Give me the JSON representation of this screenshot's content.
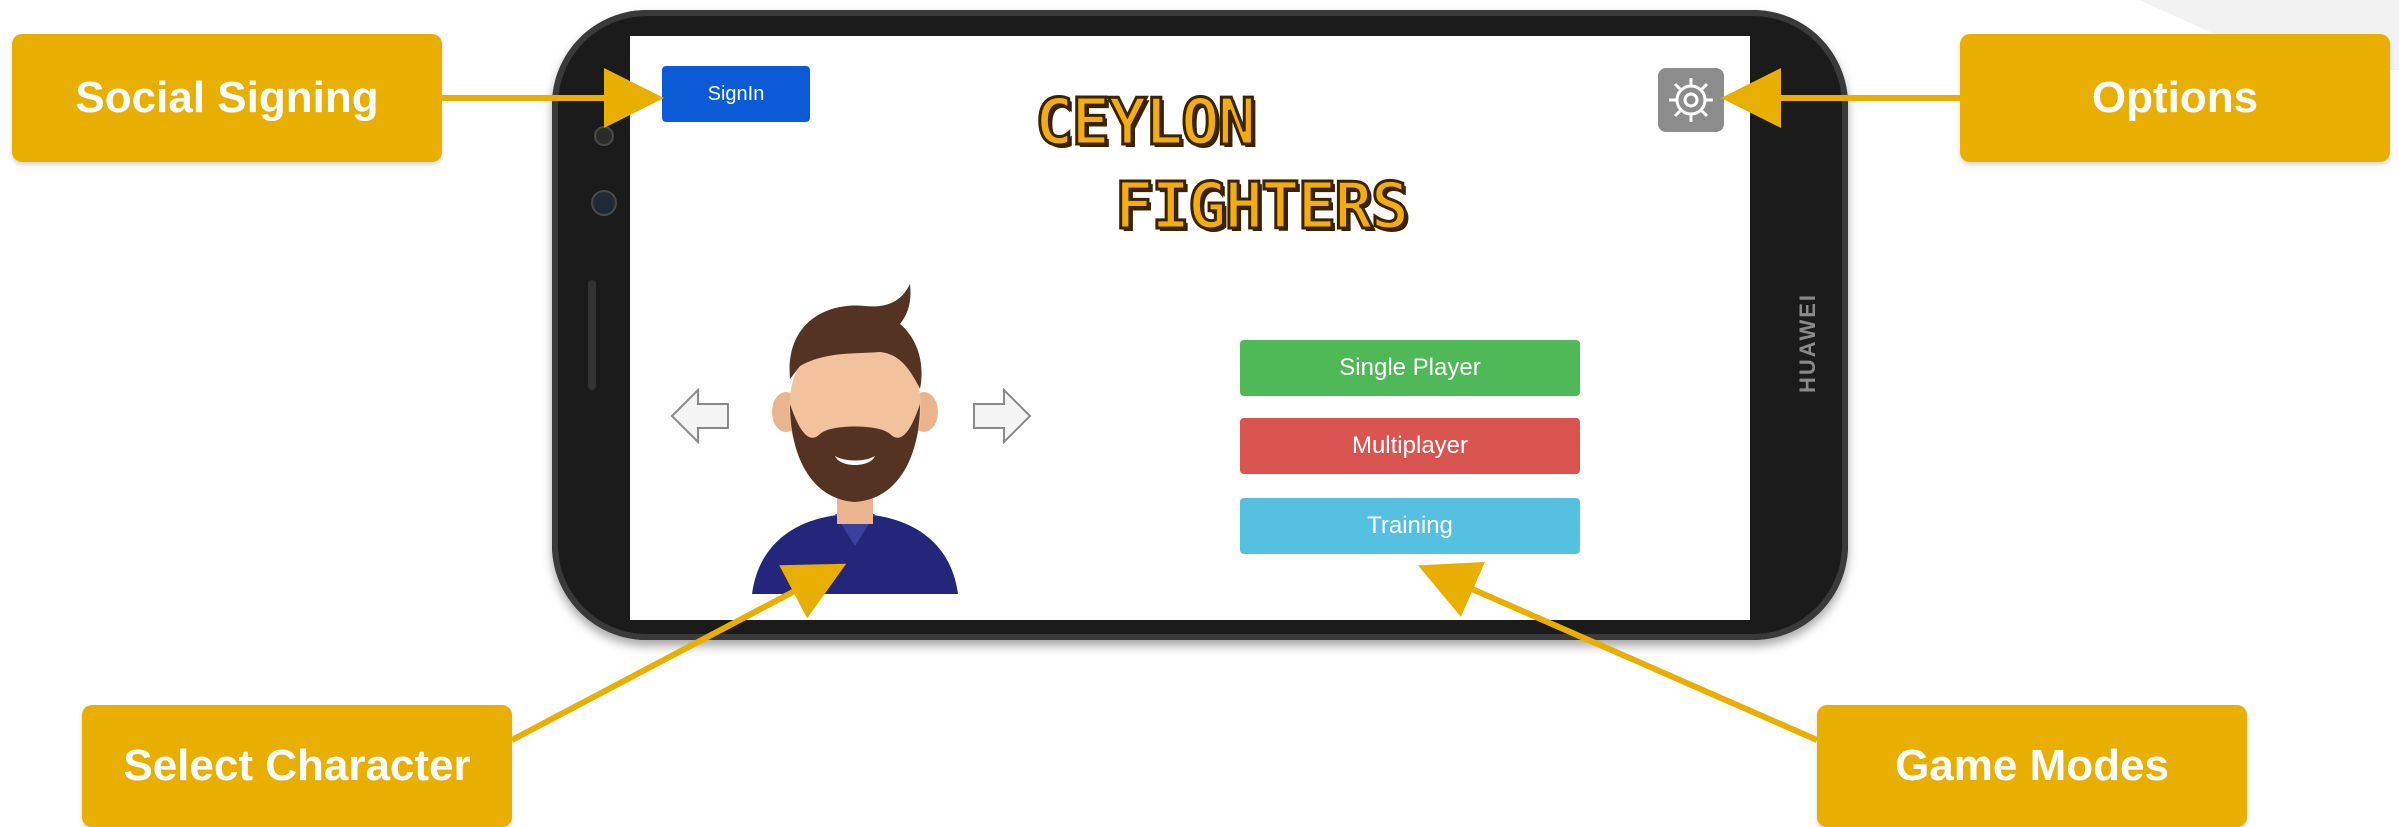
{
  "callouts": {
    "social_signing": "Social Signing",
    "options": "Options",
    "select_character": "Select Character",
    "game_modes": "Game Modes"
  },
  "phone": {
    "brand": "HUAWEI"
  },
  "app": {
    "signin_label": "SignIn",
    "logo_line1": "CEYLON",
    "logo_line2": "FIGHTERS",
    "modes": {
      "single_player": "Single Player",
      "multiplayer": "Multiplayer",
      "training": "Training"
    }
  },
  "colors": {
    "callout": "#e8ae00",
    "signin": "#0b5bd6",
    "single_player": "#4fb857",
    "multiplayer": "#d9534f",
    "training": "#55c0e0",
    "settings": "#8c8c8c"
  },
  "icons": {
    "settings": "gear-icon",
    "previous_character": "arrow-left-icon",
    "next_character": "arrow-right-icon",
    "character": "avatar-icon"
  }
}
